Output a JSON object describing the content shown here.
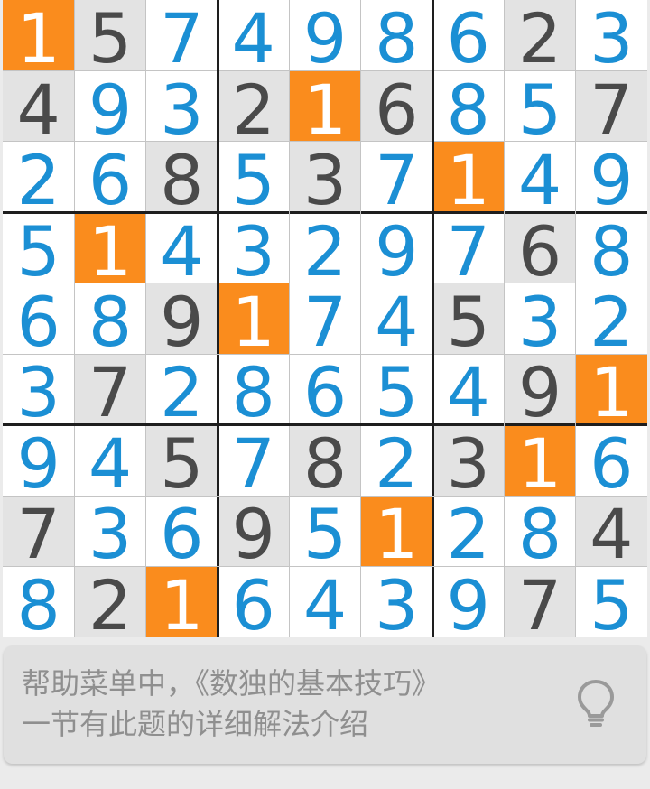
{
  "board": {
    "cells": [
      [
        {
          "v": "1",
          "s": "hl"
        },
        {
          "v": "5",
          "s": "given"
        },
        {
          "v": "7",
          "s": "user"
        },
        {
          "v": "4",
          "s": "user"
        },
        {
          "v": "9",
          "s": "user"
        },
        {
          "v": "8",
          "s": "user"
        },
        {
          "v": "6",
          "s": "user"
        },
        {
          "v": "2",
          "s": "given"
        },
        {
          "v": "3",
          "s": "user"
        }
      ],
      [
        {
          "v": "4",
          "s": "given"
        },
        {
          "v": "9",
          "s": "user"
        },
        {
          "v": "3",
          "s": "user"
        },
        {
          "v": "2",
          "s": "given"
        },
        {
          "v": "1",
          "s": "hl"
        },
        {
          "v": "6",
          "s": "given"
        },
        {
          "v": "8",
          "s": "user"
        },
        {
          "v": "5",
          "s": "user"
        },
        {
          "v": "7",
          "s": "given"
        }
      ],
      [
        {
          "v": "2",
          "s": "user"
        },
        {
          "v": "6",
          "s": "user"
        },
        {
          "v": "8",
          "s": "given"
        },
        {
          "v": "5",
          "s": "user"
        },
        {
          "v": "3",
          "s": "given"
        },
        {
          "v": "7",
          "s": "user"
        },
        {
          "v": "1",
          "s": "hl"
        },
        {
          "v": "4",
          "s": "user"
        },
        {
          "v": "9",
          "s": "user"
        }
      ],
      [
        {
          "v": "5",
          "s": "user"
        },
        {
          "v": "1",
          "s": "hl"
        },
        {
          "v": "4",
          "s": "user"
        },
        {
          "v": "3",
          "s": "user"
        },
        {
          "v": "2",
          "s": "user"
        },
        {
          "v": "9",
          "s": "user"
        },
        {
          "v": "7",
          "s": "user"
        },
        {
          "v": "6",
          "s": "given"
        },
        {
          "v": "8",
          "s": "user"
        }
      ],
      [
        {
          "v": "6",
          "s": "user"
        },
        {
          "v": "8",
          "s": "user"
        },
        {
          "v": "9",
          "s": "given"
        },
        {
          "v": "1",
          "s": "hl"
        },
        {
          "v": "7",
          "s": "user"
        },
        {
          "v": "4",
          "s": "user"
        },
        {
          "v": "5",
          "s": "given"
        },
        {
          "v": "3",
          "s": "user"
        },
        {
          "v": "2",
          "s": "user"
        }
      ],
      [
        {
          "v": "3",
          "s": "user"
        },
        {
          "v": "7",
          "s": "given"
        },
        {
          "v": "2",
          "s": "user"
        },
        {
          "v": "8",
          "s": "user"
        },
        {
          "v": "6",
          "s": "user"
        },
        {
          "v": "5",
          "s": "user"
        },
        {
          "v": "4",
          "s": "user"
        },
        {
          "v": "9",
          "s": "given"
        },
        {
          "v": "1",
          "s": "hl"
        }
      ],
      [
        {
          "v": "9",
          "s": "user"
        },
        {
          "v": "4",
          "s": "user"
        },
        {
          "v": "5",
          "s": "given"
        },
        {
          "v": "7",
          "s": "user"
        },
        {
          "v": "8",
          "s": "given"
        },
        {
          "v": "2",
          "s": "user"
        },
        {
          "v": "3",
          "s": "given"
        },
        {
          "v": "1",
          "s": "hl"
        },
        {
          "v": "6",
          "s": "user"
        }
      ],
      [
        {
          "v": "7",
          "s": "given"
        },
        {
          "v": "3",
          "s": "user"
        },
        {
          "v": "6",
          "s": "user"
        },
        {
          "v": "9",
          "s": "given"
        },
        {
          "v": "5",
          "s": "user"
        },
        {
          "v": "1",
          "s": "hl"
        },
        {
          "v": "2",
          "s": "user"
        },
        {
          "v": "8",
          "s": "user"
        },
        {
          "v": "4",
          "s": "given"
        }
      ],
      [
        {
          "v": "8",
          "s": "user"
        },
        {
          "v": "2",
          "s": "given"
        },
        {
          "v": "1",
          "s": "hl"
        },
        {
          "v": "6",
          "s": "user"
        },
        {
          "v": "4",
          "s": "user"
        },
        {
          "v": "3",
          "s": "user"
        },
        {
          "v": "9",
          "s": "user"
        },
        {
          "v": "7",
          "s": "given"
        },
        {
          "v": "5",
          "s": "user"
        }
      ]
    ],
    "colors": {
      "given_bg": "#e3e3e3",
      "given_digit": "#4a4a4a",
      "user_digit": "#1b8fd4",
      "highlight_bg": "#fa8c1d",
      "highlight_digit": "#ffffff"
    }
  },
  "hint": {
    "text_line1": "帮助菜单中，《数独的基本技巧》",
    "text_line2": "一节有此题的详细解法介绍",
    "icon": "lightbulb-icon"
  }
}
